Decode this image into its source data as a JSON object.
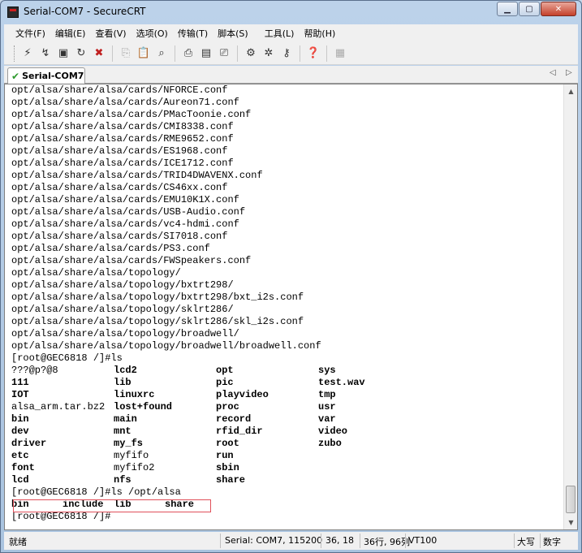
{
  "window": {
    "title": "Serial-COM7 - SecureCRT"
  },
  "menu": [
    "文件(F)",
    "编辑(E)",
    "查看(V)",
    "选项(O)",
    "传输(T)",
    "脚本(S)",
    "工具(L)",
    "帮助(H)"
  ],
  "toolbar": {
    "icons": [
      "connect-icon",
      "quick-connect-icon",
      "connect-tab-icon",
      "reconnect-icon",
      "disconnect-icon",
      "copy-icon",
      "paste-icon",
      "find-icon",
      "print-icon",
      "print-setup-icon",
      "print-screen-icon",
      "session-options-icon",
      "global-options-icon",
      "keymap-icon",
      "help-icon",
      "log-icon"
    ]
  },
  "tab": {
    "label": "Serial-COM7"
  },
  "terminal": {
    "lines": [
      "opt/alsa/share/alsa/cards/NFORCE.conf",
      "opt/alsa/share/alsa/cards/Aureon71.conf",
      "opt/alsa/share/alsa/cards/PMacToonie.conf",
      "opt/alsa/share/alsa/cards/CMI8338.conf",
      "opt/alsa/share/alsa/cards/RME9652.conf",
      "opt/alsa/share/alsa/cards/ES1968.conf",
      "opt/alsa/share/alsa/cards/ICE1712.conf",
      "opt/alsa/share/alsa/cards/TRID4DWAVENX.conf",
      "opt/alsa/share/alsa/cards/CS46xx.conf",
      "opt/alsa/share/alsa/cards/EMU10K1X.conf",
      "opt/alsa/share/alsa/cards/USB-Audio.conf",
      "opt/alsa/share/alsa/cards/vc4-hdmi.conf",
      "opt/alsa/share/alsa/cards/SI7018.conf",
      "opt/alsa/share/alsa/cards/PS3.conf",
      "opt/alsa/share/alsa/cards/FWSpeakers.conf",
      "opt/alsa/share/alsa/topology/",
      "opt/alsa/share/alsa/topology/bxtrt298/",
      "opt/alsa/share/alsa/topology/bxtrt298/bxt_i2s.conf",
      "opt/alsa/share/alsa/topology/sklrt286/",
      "opt/alsa/share/alsa/topology/sklrt286/skl_i2s.conf",
      "opt/alsa/share/alsa/topology/broadwell/",
      "opt/alsa/share/alsa/topology/broadwell/broadwell.conf",
      "[root@GEC6818 /]#ls"
    ],
    "ls_rows": [
      [
        {
          "t": "???@p?@8",
          "b": false
        },
        {
          "t": "lcd2",
          "b": true
        },
        {
          "t": "opt",
          "b": true
        },
        {
          "t": "sys",
          "b": true
        }
      ],
      [
        {
          "t": "111",
          "b": true
        },
        {
          "t": "lib",
          "b": true
        },
        {
          "t": "pic",
          "b": true
        },
        {
          "t": "test.wav",
          "b": true
        }
      ],
      [
        {
          "t": "IOT",
          "b": true
        },
        {
          "t": "linuxrc",
          "b": true
        },
        {
          "t": "playvideo",
          "b": true
        },
        {
          "t": "tmp",
          "b": true
        }
      ],
      [
        {
          "t": "alsa_arm.tar.bz2",
          "b": false
        },
        {
          "t": "lost+found",
          "b": true
        },
        {
          "t": "proc",
          "b": true
        },
        {
          "t": "usr",
          "b": true
        }
      ],
      [
        {
          "t": "bin",
          "b": true
        },
        {
          "t": "main",
          "b": true
        },
        {
          "t": "record",
          "b": true
        },
        {
          "t": "var",
          "b": true
        }
      ],
      [
        {
          "t": "dev",
          "b": true
        },
        {
          "t": "mnt",
          "b": true
        },
        {
          "t": "rfid_dir",
          "b": true
        },
        {
          "t": "video",
          "b": true
        }
      ],
      [
        {
          "t": "driver",
          "b": true
        },
        {
          "t": "my_fs",
          "b": true
        },
        {
          "t": "root",
          "b": true
        },
        {
          "t": "zubo",
          "b": true
        }
      ],
      [
        {
          "t": "etc",
          "b": true
        },
        {
          "t": "myfifo",
          "b": false
        },
        {
          "t": "run",
          "b": true
        },
        {
          "t": "",
          "b": false
        }
      ],
      [
        {
          "t": "font",
          "b": true
        },
        {
          "t": "myfifo2",
          "b": false
        },
        {
          "t": "sbin",
          "b": true
        },
        {
          "t": "",
          "b": false
        }
      ],
      [
        {
          "t": "lcd",
          "b": true
        },
        {
          "t": "nfs",
          "b": true
        },
        {
          "t": "share",
          "b": true
        },
        {
          "t": "",
          "b": false
        }
      ]
    ],
    "cmd2": "[root@GEC6818 /]#ls /opt/alsa",
    "alsa_ls": [
      "bin",
      "include",
      "lib",
      "share"
    ],
    "prompt": "[root@GEC6818 /]#",
    "highlight_color": "#e0505a"
  },
  "status": {
    "ready": "就绪",
    "serial": "Serial: COM7, 115200",
    "cursor": "36, 18",
    "size": "36行, 96列",
    "emulation": "VT100",
    "caps": "大写",
    "num": "数字"
  }
}
